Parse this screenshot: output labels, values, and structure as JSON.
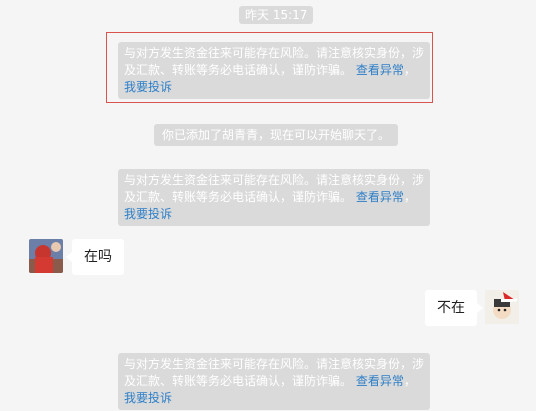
{
  "chat": {
    "timestamp": "昨天 15:17",
    "risk_notice": {
      "text": "与对方发生资金往来可能存在风险。请注意核实身份，涉及汇款、转账等务必电话确认，谨防诈骗。",
      "link_view": "查看异常",
      "link_report": "我要投诉",
      "separator": "，"
    },
    "added_notice": "你已添加了胡青青，现在可以开始聊天了。",
    "messages": [
      {
        "side": "left",
        "text": "在吗"
      },
      {
        "side": "right",
        "text": "不在"
      }
    ],
    "colors": {
      "link": "#2e7fc8",
      "highlight_border": "#d9534f",
      "system_bg": "#dadada"
    }
  }
}
